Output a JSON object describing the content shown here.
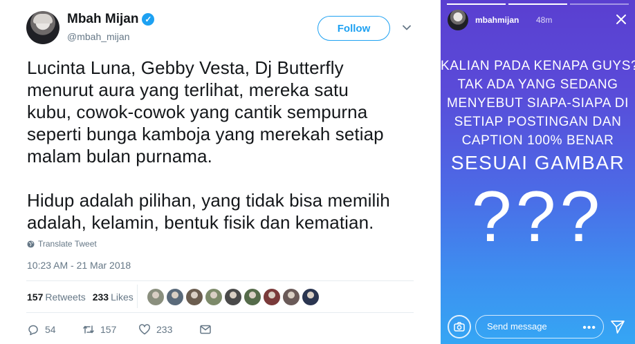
{
  "tweet": {
    "name": "Mbah Mijan",
    "handle": "@mbah_mijan",
    "follow_label": "Follow",
    "text_lines": [
      "Lucinta Luna, Gebby Vesta, Dj Butterfly",
      "menurut aura yang terlihat, mereka satu",
      "kubu, cowok-cowok yang cantik sempurna",
      "seperti bunga kamboja yang merekah setiap",
      "malam bulan purnama.",
      "Hidup adalah pilihan, yang tidak bisa memilih",
      "adalah, kelamin, bentuk fisik dan kematian."
    ],
    "translate_label": "Translate Tweet",
    "timestamp": "10:23 AM - 21 Mar 2018",
    "retweets_count": "157",
    "retweets_label": "Retweets",
    "likes_count": "233",
    "likes_label": "Likes",
    "liker_colors": [
      "#8a8f7e",
      "#5a6a7a",
      "#6b5d4f",
      "#7d8a6a",
      "#4a4a4a",
      "#556b4a",
      "#7a3a3a",
      "#6a5a58",
      "#2a3550"
    ],
    "reply_count": "54",
    "retweet_action_count": "157",
    "like_action_count": "233",
    "accent_color": "#1da1f2"
  },
  "story": {
    "username": "mbahmijan",
    "time": "48m",
    "lines": [
      "KALIAN PADA KENAPA GUYS?",
      "TAK ADA YANG SEDANG",
      "MENYEBUT SIAPA-SIAPA DI",
      "SETIAP POSTINGAN DAN",
      "CAPTION 100% BENAR"
    ],
    "big_line": "SESUAI GAMBAR",
    "question_marks": "???",
    "send_placeholder": "Send message",
    "more_dots": "•••"
  }
}
